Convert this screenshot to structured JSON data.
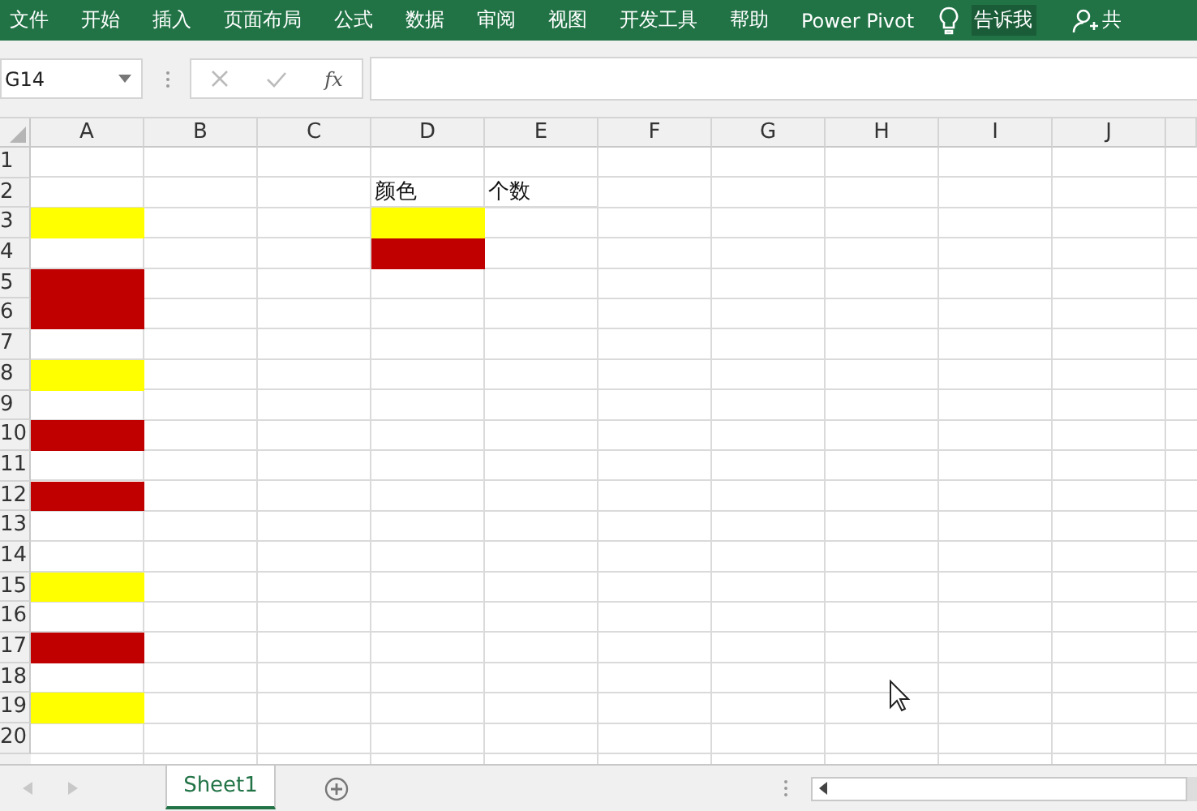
{
  "ribbon": {
    "tabs": [
      {
        "label": "文件"
      },
      {
        "label": "开始"
      },
      {
        "label": "插入"
      },
      {
        "label": "页面布局"
      },
      {
        "label": "公式"
      },
      {
        "label": "数据"
      },
      {
        "label": "审阅"
      },
      {
        "label": "视图"
      },
      {
        "label": "开发工具"
      },
      {
        "label": "帮助"
      },
      {
        "label": "Power Pivot"
      }
    ],
    "tell_me": "告诉我",
    "share": "共"
  },
  "formula_bar": {
    "name_box": "G14",
    "function_label": "fx"
  },
  "columns": [
    "A",
    "B",
    "C",
    "D",
    "E",
    "F",
    "G",
    "H",
    "I",
    "J"
  ],
  "rows": [
    {
      "label": "1"
    },
    {
      "label": "2",
      "cells": [
        {},
        {},
        {},
        {
          "text": "颜色"
        },
        {
          "text": "个数"
        }
      ]
    },
    {
      "label": "3",
      "cells": [
        {
          "color": "#ffff00"
        },
        {},
        {},
        {
          "color": "#ffff00"
        }
      ]
    },
    {
      "label": "4",
      "cells": [
        {},
        {},
        {},
        {
          "color": "#c00000"
        }
      ]
    },
    {
      "label": "5",
      "cells": [
        {
          "color": "#c00000"
        }
      ]
    },
    {
      "label": "6",
      "cells": [
        {
          "color": "#c00000"
        }
      ]
    },
    {
      "label": "7"
    },
    {
      "label": "8",
      "cells": [
        {
          "color": "#ffff00"
        }
      ]
    },
    {
      "label": "9"
    },
    {
      "label": "10",
      "cells": [
        {
          "color": "#c00000"
        }
      ]
    },
    {
      "label": "11"
    },
    {
      "label": "12",
      "cells": [
        {
          "color": "#c00000"
        }
      ]
    },
    {
      "label": "13"
    },
    {
      "label": "14"
    },
    {
      "label": "15",
      "cells": [
        {
          "color": "#ffff00"
        }
      ]
    },
    {
      "label": "16"
    },
    {
      "label": "17",
      "cells": [
        {
          "color": "#c00000"
        }
      ]
    },
    {
      "label": "18"
    },
    {
      "label": "19",
      "cells": [
        {
          "color": "#ffff00"
        }
      ]
    },
    {
      "label": "20"
    }
  ],
  "sheets": [
    {
      "label": "Sheet1",
      "selected": true
    }
  ]
}
